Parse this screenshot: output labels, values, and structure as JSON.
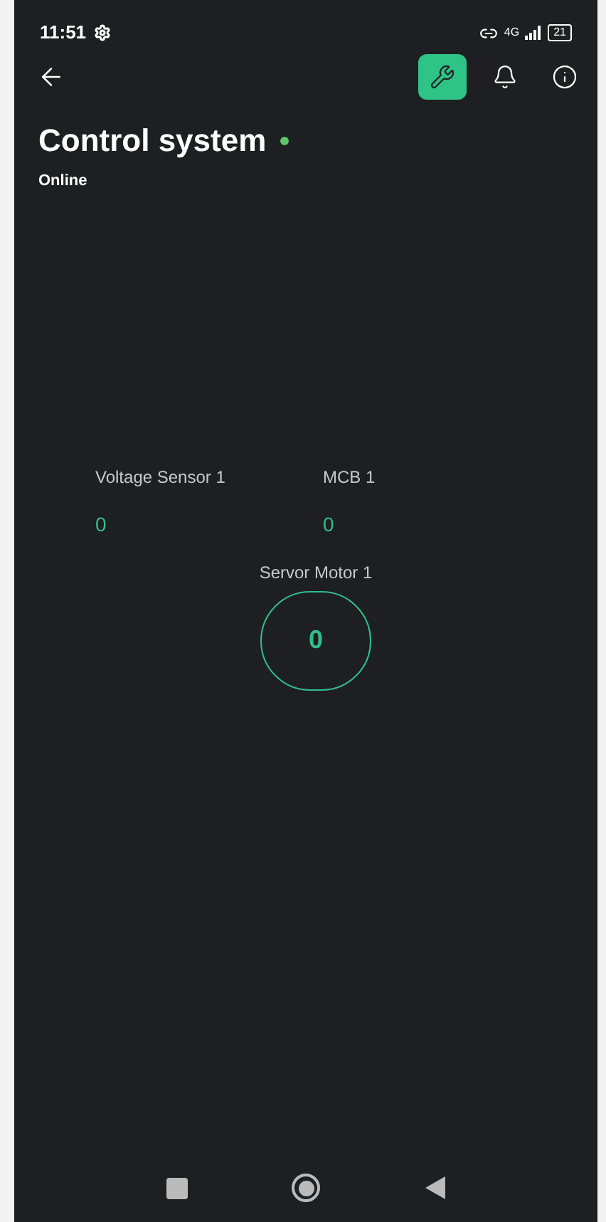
{
  "status_bar": {
    "time": "11:51",
    "network": "4G",
    "battery": "21"
  },
  "toolbar": {
    "buttons": [
      {
        "kind": "wrench",
        "selected": true
      },
      {
        "kind": "bell",
        "selected": false
      },
      {
        "kind": "info",
        "selected": false
      }
    ]
  },
  "device": {
    "title": "Control system",
    "online": true,
    "status": "Online"
  },
  "widgets": [
    {
      "kind": "value",
      "label": "Voltage Sensor 1",
      "value": "0"
    },
    {
      "kind": "value",
      "label": "MCB 1",
      "value": "0"
    },
    {
      "kind": "gauge",
      "label": "Servor Motor 1",
      "value": "0"
    }
  ]
}
